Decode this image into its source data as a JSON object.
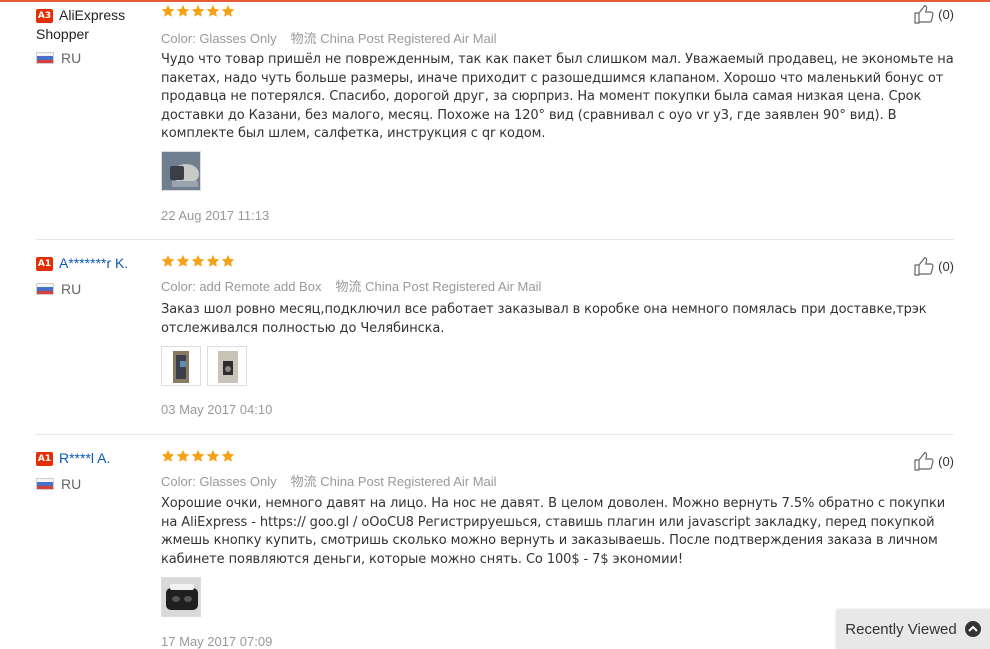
{
  "reviews": [
    {
      "badge": "A3",
      "name": "AliExpress Shopper",
      "country": "RU",
      "color_label": "Color:",
      "color_value": "Glasses Only",
      "shipping_prefix": "物流",
      "shipping": "China Post Registered Air Mail",
      "text": "Чудо что товар пришёл не поврежденным, так как пакет был слишком мал. Уважаемый продавец, не экономьте на пакетах, надо чуть больше размеры, иначе приходит с разошедшимся клапаном. Хорошо что маленький бонус от продавца не потерялся. Спасибо, дорогой друг, за сюрприз. На момент покупки была самая низкая цена. Срок доставки до Казани, без малого, месяц. Похоже на 120° вид (сравнивал с oyo vr y3, где заявлен 90° вид). В комплекте был шлем, салфетка, инструкция с qr кодом.",
      "date": "22 Aug 2017 11:13",
      "helpful": "(0)",
      "rating": 5,
      "photos": 1
    },
    {
      "badge": "A1",
      "name": "A*******r K.",
      "country": "RU",
      "color_label": "Color:",
      "color_value": "add Remote add Box",
      "shipping_prefix": "物流",
      "shipping": "China Post Registered Air Mail",
      "text": "Заказ шол ровно месяц,подключил все работает заказывал в коробке она немного помялась при доставке,трэк отслеживался полностью до Челябинска.",
      "date": "03 May 2017 04:10",
      "helpful": "(0)",
      "rating": 5,
      "photos": 2
    },
    {
      "badge": "A1",
      "name": "R****l A.",
      "country": "RU",
      "color_label": "Color:",
      "color_value": "Glasses Only",
      "shipping_prefix": "物流",
      "shipping": "China Post Registered Air Mail",
      "text": "Хорошие очки, немного давят на лицо. На нос не давят. В целом доволен. Можно вернуть 7.5% обратно с покупки на AliExpress - https:// goo.gl / oOoCU8 Регистрируешься, ставишь плагин или javascript закладку, перед покупкой жмешь кнопку купить, смотришь сколько можно вернуть и заказываешь. После подтверждения заказа в личном кабинете появляются деньги, которые можно снять. Со 100$ - 7$ экономии!",
      "date": "17 May 2017 07:09",
      "helpful": "(0)",
      "rating": 5,
      "photos": 1
    }
  ],
  "recently_viewed": "Recently Viewed",
  "colors": {
    "accent": "#e62e04",
    "star": "#f7a114",
    "link": "#0a59b8"
  }
}
